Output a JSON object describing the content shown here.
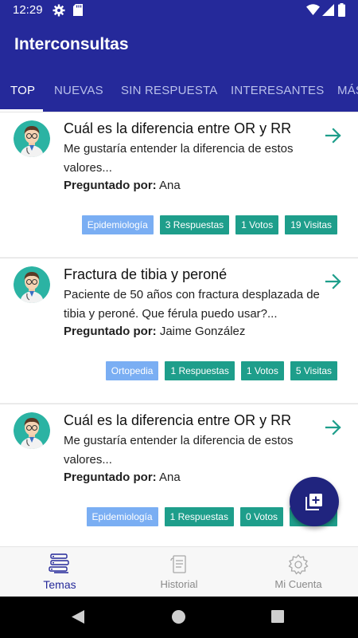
{
  "status_bar": {
    "time": "12:29",
    "icons": [
      "gear-icon",
      "sd-card-icon",
      "wifi-icon",
      "signal-icon",
      "battery-icon"
    ]
  },
  "app_bar": {
    "title": "Interconsultas"
  },
  "tabs": [
    {
      "label": "TOP",
      "active": true
    },
    {
      "label": "NUEVAS",
      "active": false
    },
    {
      "label": "SIN RESPUESTA",
      "active": false
    },
    {
      "label": "INTERESANTES",
      "active": false
    },
    {
      "label": "MÁS",
      "active": false
    }
  ],
  "questions": [
    {
      "title": "Cuál es la diferencia entre OR y RR",
      "body": "Me gustaría entender la diferencia de estos valores...",
      "author_label": "Preguntado por:",
      "author": "Ana",
      "category": "Epidemiología",
      "answers": "3 Respuestas",
      "votes": "1 Votos",
      "visits": "19 Visitas"
    },
    {
      "title": "Fractura de tibia y peroné",
      "body": "Paciente de 50 años con fractura desplazada de tibia y peroné. Que férula puedo usar?...",
      "author_label": "Preguntado por:",
      "author": "Jaime González",
      "category": "Ortopedia",
      "answers": "1 Respuestas",
      "votes": "1 Votos",
      "visits": "5 Visitas"
    },
    {
      "title": "Cuál es la diferencia entre OR y RR",
      "body": "Me gustaría entender la diferencia de estos valores...",
      "author_label": "Preguntado por:",
      "author": "Ana",
      "category": "Epidemiología",
      "answers": "1 Respuestas",
      "votes": "0 Votos",
      "visits": ""
    }
  ],
  "fab": {
    "icon": "add-library-icon"
  },
  "bottom_nav": [
    {
      "label": "Temas",
      "icon": "topics-icon",
      "active": true
    },
    {
      "label": "Historial",
      "icon": "history-icon",
      "active": false
    },
    {
      "label": "Mi Cuenta",
      "icon": "settings-gear-icon",
      "active": false
    }
  ],
  "colors": {
    "primary": "#25299a",
    "accent": "#1e9e8b",
    "category_chip": "#7aaef3",
    "fab": "#20247e"
  }
}
